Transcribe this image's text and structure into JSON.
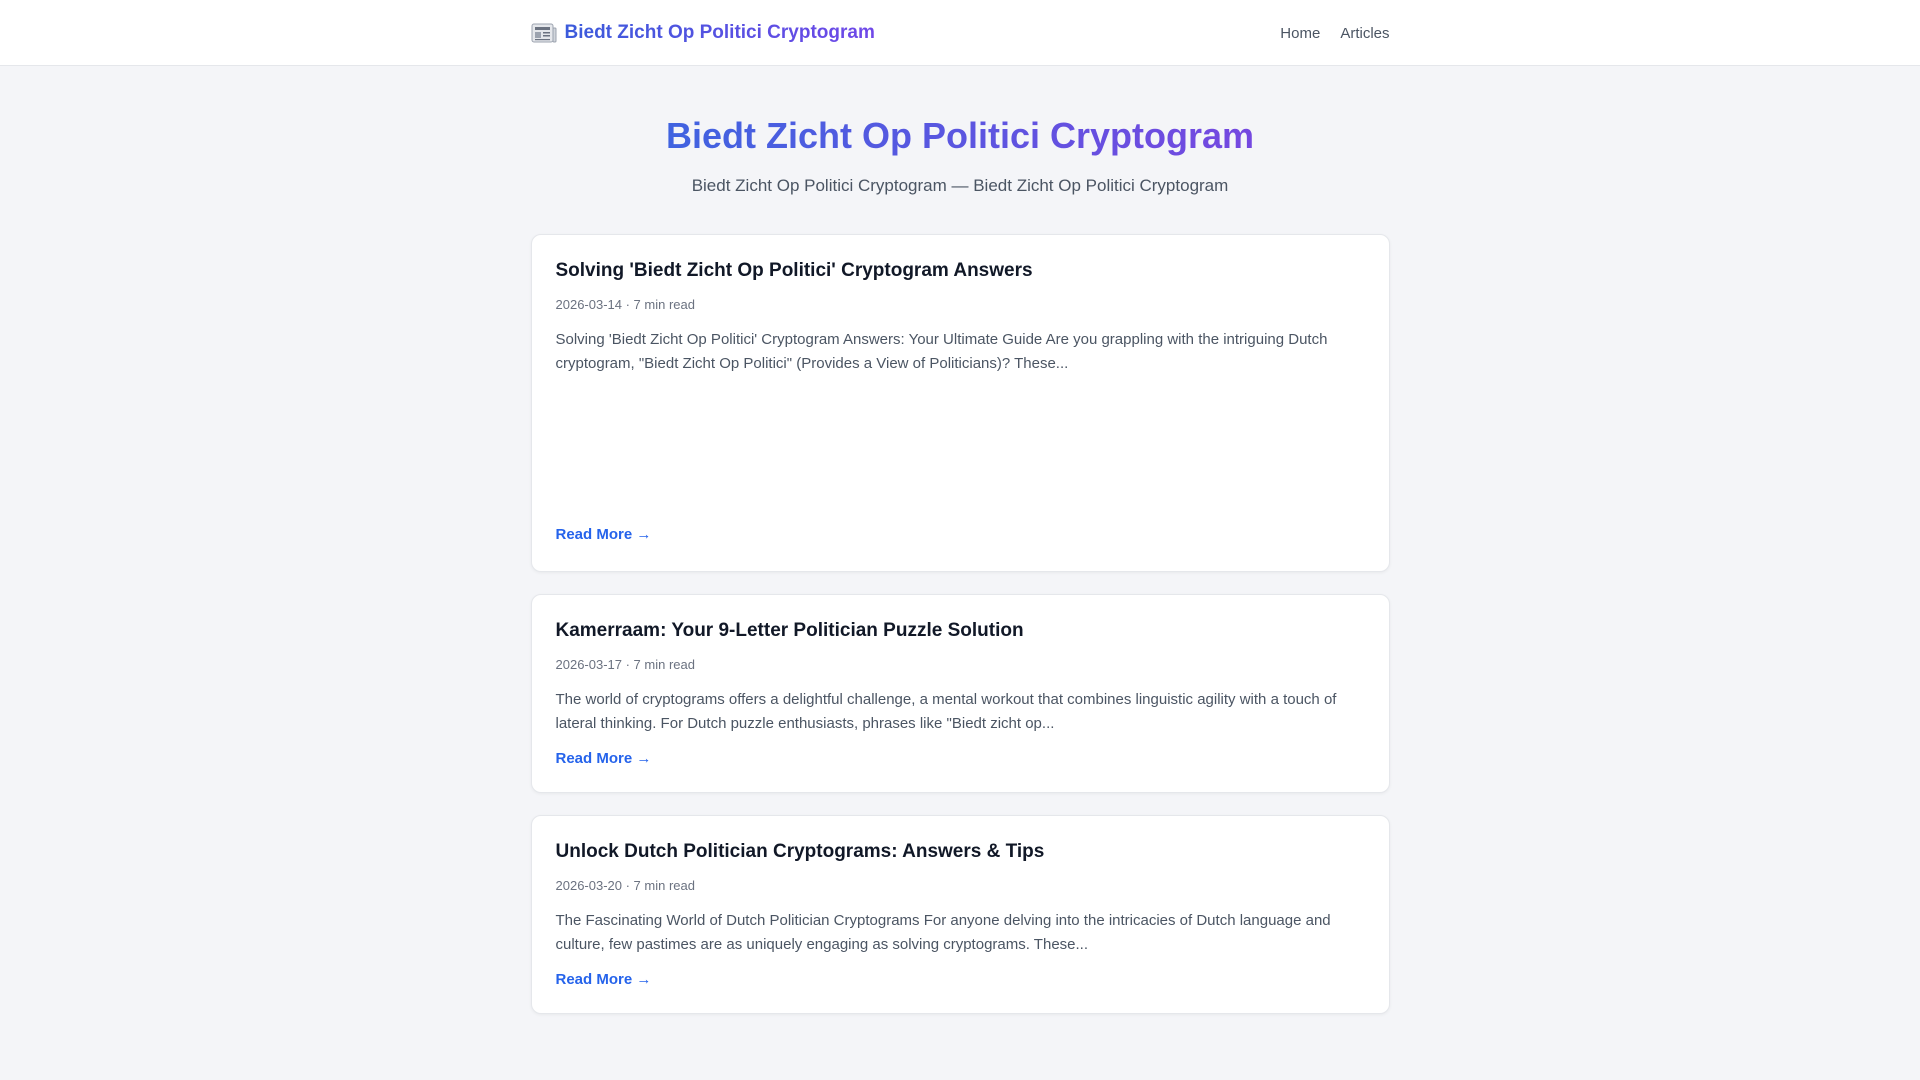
{
  "header": {
    "brand": "Biedt Zicht Op Politici Cryptogram",
    "brand_icon": "newspaper-icon",
    "nav": {
      "home": "Home",
      "articles": "Articles"
    }
  },
  "hero": {
    "title": "Biedt Zicht Op Politici Cryptogram",
    "subtitle": "Biedt Zicht Op Politici Cryptogram — Biedt Zicht Op Politici Cryptogram"
  },
  "articles": [
    {
      "title": "Solving 'Biedt Zicht Op Politici' Cryptogram Answers",
      "meta": "2026-03-14 · 7 min read",
      "excerpt": "Solving 'Biedt Zicht Op Politici' Cryptogram Answers: Your Ultimate Guide Are you grappling with the intriguing Dutch cryptogram, \"Biedt Zicht Op Politici\" (Provides a View of Politicians)? These...",
      "read_more": "Read More →"
    },
    {
      "title": "Kamerraam: Your 9-Letter Politician Puzzle Solution",
      "meta": "2026-03-17 · 7 min read",
      "excerpt": "The world of cryptograms offers a delightful challenge, a mental workout that combines linguistic agility with a touch of lateral thinking. For Dutch puzzle enthusiasts, phrases like \"Biedt zicht op...",
      "read_more": "Read More →"
    },
    {
      "title": "Unlock Dutch Politician Cryptograms: Answers & Tips",
      "meta": "2026-03-20 · 7 min read",
      "excerpt": "The Fascinating World of Dutch Politician Cryptograms For anyone delving into the intricacies of Dutch language and culture, few pastimes are as uniquely engaging as solving cryptograms. These...",
      "read_more": "Read More →"
    }
  ],
  "colors": {
    "accent_start": "#3b5bdb",
    "accent_end": "#7048e8",
    "link": "#2563eb",
    "background": "#f4f5f8"
  }
}
